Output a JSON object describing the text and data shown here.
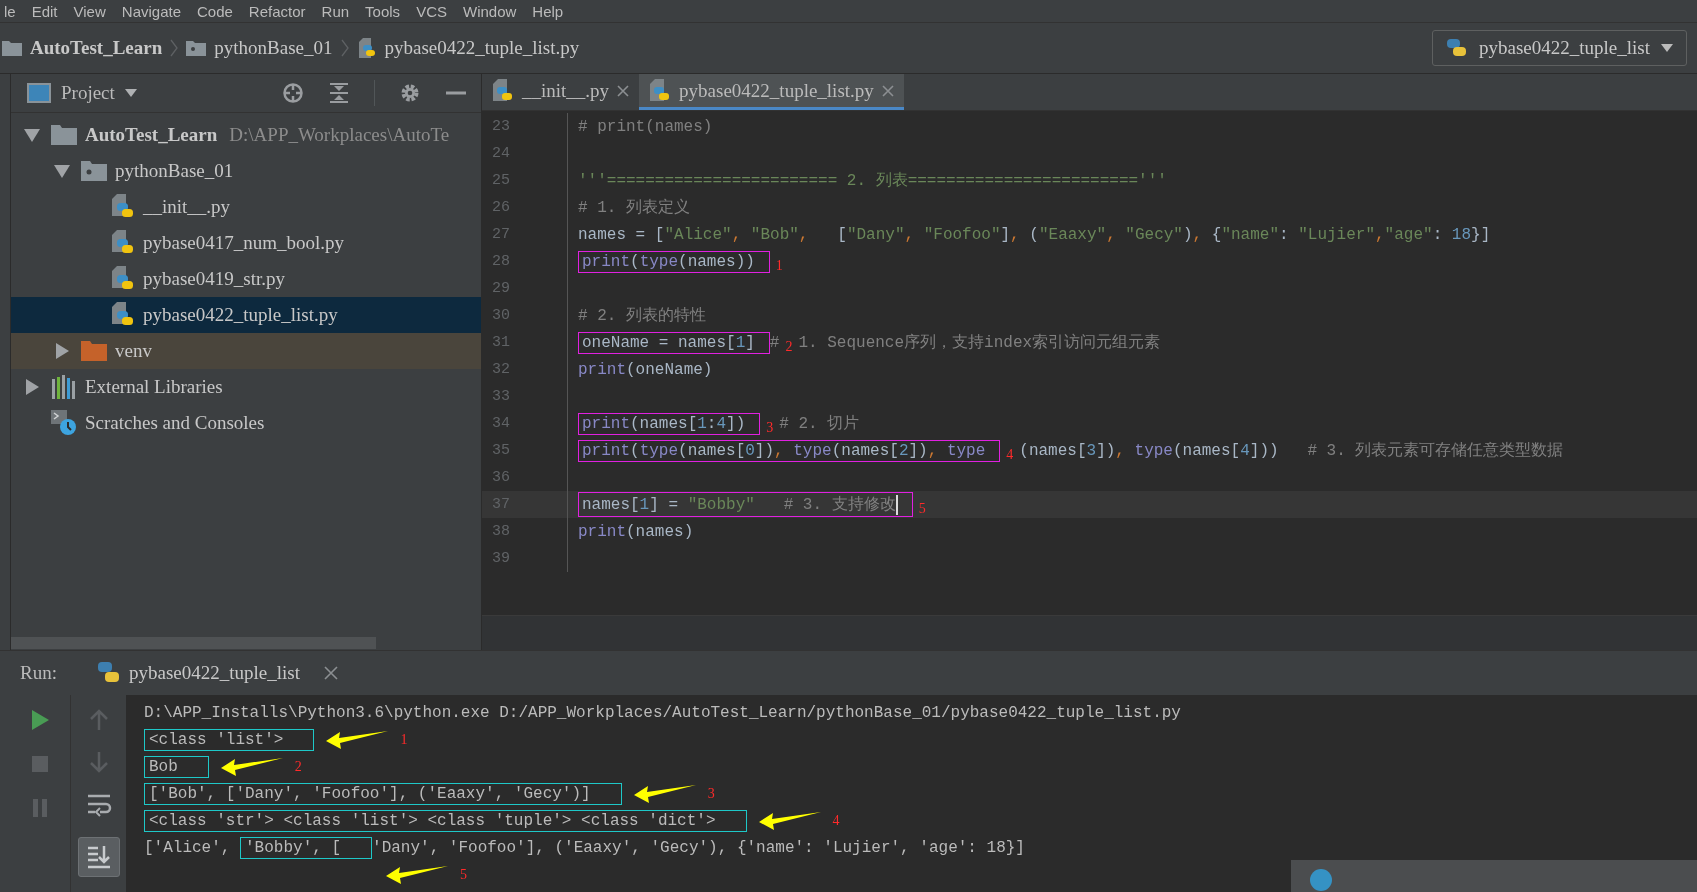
{
  "menu": [
    "le",
    "Edit",
    "View",
    "Navigate",
    "Code",
    "Refactor",
    "Run",
    "Tools",
    "VCS",
    "Window",
    "Help"
  ],
  "breadcrumbs": [
    {
      "label": "AutoTest_Learn",
      "kind": "project"
    },
    {
      "label": "pythonBase_01",
      "kind": "folder"
    },
    {
      "label": "pybase0422_tuple_list.py",
      "kind": "file"
    }
  ],
  "run_config": "pybase0422_tuple_list",
  "project_panel": {
    "title": "Project",
    "tree": [
      {
        "label": "AutoTest_Learn",
        "detail": "D:\\APP_Workplaces\\AutoTe",
        "kind": "project",
        "expanded": true,
        "selected": false,
        "children": [
          {
            "label": "pythonBase_01",
            "kind": "module",
            "expanded": true,
            "selected": false,
            "children": [
              {
                "label": "__init__.py",
                "kind": "python",
                "selected": false
              },
              {
                "label": "pybase0417_num_bool.py",
                "kind": "python",
                "selected": false
              },
              {
                "label": "pybase0419_str.py",
                "kind": "python",
                "selected": false
              },
              {
                "label": "pybase0422_tuple_list.py",
                "kind": "python",
                "selected": true
              }
            ]
          },
          {
            "label": "venv",
            "kind": "excluded",
            "expanded": false,
            "selected": false
          }
        ]
      },
      {
        "label": "External Libraries",
        "kind": "libraries",
        "expanded": false,
        "selected": false
      },
      {
        "label": "Scratches and Consoles",
        "kind": "scratches",
        "selected": false
      }
    ]
  },
  "editor": {
    "tabs": [
      {
        "label": "__init__.py",
        "selected": false
      },
      {
        "label": "pybase0422_tuple_list.py",
        "selected": true
      }
    ],
    "lines": [
      {
        "number": "23",
        "current": false,
        "segments": [
          {
            "kind": "text",
            "tokens": [
              {
                "kind": "comment",
                "text": "# print(names)"
              }
            ]
          }
        ]
      },
      {
        "number": "24",
        "current": false
      },
      {
        "number": "25",
        "current": false,
        "segments": [
          {
            "kind": "text",
            "tokens": [
              {
                "kind": "string",
                "text": "'''======================== 2. 列表========================'''"
              }
            ]
          }
        ]
      },
      {
        "number": "26",
        "current": false,
        "segments": [
          {
            "kind": "text",
            "tokens": [
              {
                "kind": "comment",
                "text": "# 1. 列表定义"
              }
            ]
          }
        ]
      },
      {
        "number": "27",
        "current": false,
        "segments": [
          {
            "kind": "text",
            "tokens": [
              {
                "kind": "plain",
                "text": "names = ["
              },
              {
                "kind": "string",
                "text": "\"Alice\""
              },
              {
                "kind": "punct",
                "text": ", "
              },
              {
                "kind": "string",
                "text": "\"Bob\""
              },
              {
                "kind": "punct",
                "text": ",  "
              },
              {
                "kind": "plain",
                "text": " ["
              },
              {
                "kind": "string",
                "text": "\"Dany\""
              },
              {
                "kind": "punct",
                "text": ", "
              },
              {
                "kind": "string",
                "text": "\"Foofoo\""
              },
              {
                "kind": "plain",
                "text": "]"
              },
              {
                "kind": "punct",
                "text": ", "
              },
              {
                "kind": "plain",
                "text": "("
              },
              {
                "kind": "string",
                "text": "\"Eaaxy\""
              },
              {
                "kind": "punct",
                "text": ", "
              },
              {
                "kind": "string",
                "text": "\"Gecy\""
              },
              {
                "kind": "plain",
                "text": ")"
              },
              {
                "kind": "punct",
                "text": ", "
              },
              {
                "kind": "plain",
                "text": "{"
              },
              {
                "kind": "string",
                "text": "\"name\""
              },
              {
                "kind": "plain",
                "text": ": "
              },
              {
                "kind": "string",
                "text": "\"Lujier\""
              },
              {
                "kind": "punct",
                "text": ","
              },
              {
                "kind": "string",
                "text": "\"age\""
              },
              {
                "kind": "plain",
                "text": ": "
              },
              {
                "kind": "number",
                "text": "18"
              },
              {
                "kind": "plain",
                "text": "}]"
              }
            ]
          }
        ]
      },
      {
        "number": "28",
        "current": false,
        "segments": [
          {
            "kind": "box",
            "tokens": [
              {
                "kind": "keyword",
                "text": "print"
              },
              {
                "kind": "plain",
                "text": "("
              },
              {
                "kind": "keyword",
                "text": "type"
              },
              {
                "kind": "plain",
                "text": "(names))"
              }
            ]
          },
          {
            "kind": "note",
            "text": "1"
          }
        ]
      },
      {
        "number": "29",
        "current": false
      },
      {
        "number": "30",
        "current": false,
        "segments": [
          {
            "kind": "text",
            "tokens": [
              {
                "kind": "comment",
                "text": "# 2. 列表的特性"
              }
            ]
          }
        ]
      },
      {
        "number": "31",
        "current": false,
        "segments": [
          {
            "kind": "box",
            "tokens": [
              {
                "kind": "plain",
                "text": "oneName = names["
              },
              {
                "kind": "number",
                "text": "1"
              },
              {
                "kind": "plain",
                "text": "]"
              }
            ]
          },
          {
            "kind": "text",
            "tokens": [
              {
                "kind": "comment",
                "text": "#"
              }
            ]
          },
          {
            "kind": "note",
            "text": "2"
          },
          {
            "kind": "text",
            "tokens": [
              {
                "kind": "comment",
                "text": "1. Sequence序列，支持index索引访问元组元素"
              }
            ]
          }
        ]
      },
      {
        "number": "32",
        "current": false,
        "segments": [
          {
            "kind": "text",
            "tokens": [
              {
                "kind": "keyword",
                "text": "print"
              },
              {
                "kind": "plain",
                "text": "(oneName)"
              }
            ]
          }
        ]
      },
      {
        "number": "33",
        "current": false
      },
      {
        "number": "34",
        "current": false,
        "segments": [
          {
            "kind": "box",
            "tokens": [
              {
                "kind": "keyword",
                "text": "print"
              },
              {
                "kind": "plain",
                "text": "(names["
              },
              {
                "kind": "number",
                "text": "1"
              },
              {
                "kind": "plain",
                "text": ":"
              },
              {
                "kind": "number",
                "text": "4"
              },
              {
                "kind": "plain",
                "text": "])"
              }
            ]
          },
          {
            "kind": "note",
            "text": "3"
          },
          {
            "kind": "text",
            "tokens": [
              {
                "kind": "comment",
                "text": "# 2. 切片"
              }
            ]
          }
        ]
      },
      {
        "number": "35",
        "current": false,
        "segments": [
          {
            "kind": "box",
            "tokens": [
              {
                "kind": "keyword",
                "text": "print"
              },
              {
                "kind": "plain",
                "text": "("
              },
              {
                "kind": "keyword",
                "text": "type"
              },
              {
                "kind": "plain",
                "text": "(names["
              },
              {
                "kind": "number",
                "text": "0"
              },
              {
                "kind": "plain",
                "text": "])"
              },
              {
                "kind": "punct",
                "text": ", "
              },
              {
                "kind": "keyword",
                "text": "type"
              },
              {
                "kind": "plain",
                "text": "(names["
              },
              {
                "kind": "number",
                "text": "2"
              },
              {
                "kind": "plain",
                "text": "])"
              },
              {
                "kind": "punct",
                "text": ", "
              },
              {
                "kind": "keyword",
                "text": "type"
              }
            ]
          },
          {
            "kind": "note",
            "text": "4"
          },
          {
            "kind": "text",
            "tokens": [
              {
                "kind": "plain",
                "text": "(names["
              },
              {
                "kind": "number",
                "text": "3"
              },
              {
                "kind": "plain",
                "text": "])"
              },
              {
                "kind": "punct",
                "text": ", "
              },
              {
                "kind": "keyword",
                "text": "type"
              },
              {
                "kind": "plain",
                "text": "(names["
              },
              {
                "kind": "number",
                "text": "4"
              },
              {
                "kind": "plain",
                "text": "]))"
              },
              {
                "kind": "comment",
                "text": "   # 3. 列表元素可存储任意类型数据"
              }
            ]
          }
        ]
      },
      {
        "number": "36",
        "current": false
      },
      {
        "number": "37",
        "current": true,
        "segments": [
          {
            "kind": "box",
            "tokens": [
              {
                "kind": "plain",
                "text": "names["
              },
              {
                "kind": "number",
                "text": "1"
              },
              {
                "kind": "plain",
                "text": "] = "
              },
              {
                "kind": "string",
                "text": "\"Bobby\""
              },
              {
                "kind": "comment",
                "text": "   # 3. 支持修改"
              }
            ]
          },
          {
            "kind": "note",
            "text": "5"
          }
        ]
      },
      {
        "number": "38",
        "current": false,
        "segments": [
          {
            "kind": "text",
            "tokens": [
              {
                "kind": "keyword",
                "text": "print"
              },
              {
                "kind": "plain",
                "text": "(names)"
              }
            ]
          }
        ]
      },
      {
        "number": "39",
        "current": false
      }
    ]
  },
  "run_panel": {
    "label": "Run:",
    "tab": "pybase0422_tuple_list",
    "output": [
      {
        "segments": [
          {
            "kind": "text",
            "text": "D:\\APP_Installs\\Python3.6\\python.exe D:/APP_Workplaces/AutoTest_Learn/pythonBase_01/pybase0422_tuple_list.py"
          }
        ]
      },
      {
        "segments": [
          {
            "kind": "box",
            "text": "<class 'list'>"
          },
          {
            "kind": "arrow"
          },
          {
            "kind": "note",
            "text": "1"
          }
        ]
      },
      {
        "segments": [
          {
            "kind": "box",
            "text": "Bob"
          },
          {
            "kind": "arrow"
          },
          {
            "kind": "note",
            "text": "2"
          }
        ]
      },
      {
        "segments": [
          {
            "kind": "box",
            "text": "['Bob', ['Dany', 'Foofoo'], ('Eaaxy', 'Gecy')]"
          },
          {
            "kind": "arrow"
          },
          {
            "kind": "note",
            "text": "3"
          }
        ]
      },
      {
        "segments": [
          {
            "kind": "box",
            "text": "<class 'str'> <class 'list'> <class 'tuple'> <class 'dict'>"
          },
          {
            "kind": "arrow"
          },
          {
            "kind": "note",
            "text": "4"
          }
        ]
      },
      {
        "segments": [
          {
            "kind": "text",
            "text": "['Alice', "
          },
          {
            "kind": "box",
            "text": "'Bobby', ["
          },
          {
            "kind": "text",
            "text": "'Dany', 'Foofoo'], ('Eaaxy', 'Gecy'), {'name': 'Lujier', 'age': 18}]"
          }
        ]
      },
      {
        "segments": [
          {
            "kind": "arrow"
          },
          {
            "kind": "note",
            "text": "5"
          }
        ]
      }
    ]
  }
}
